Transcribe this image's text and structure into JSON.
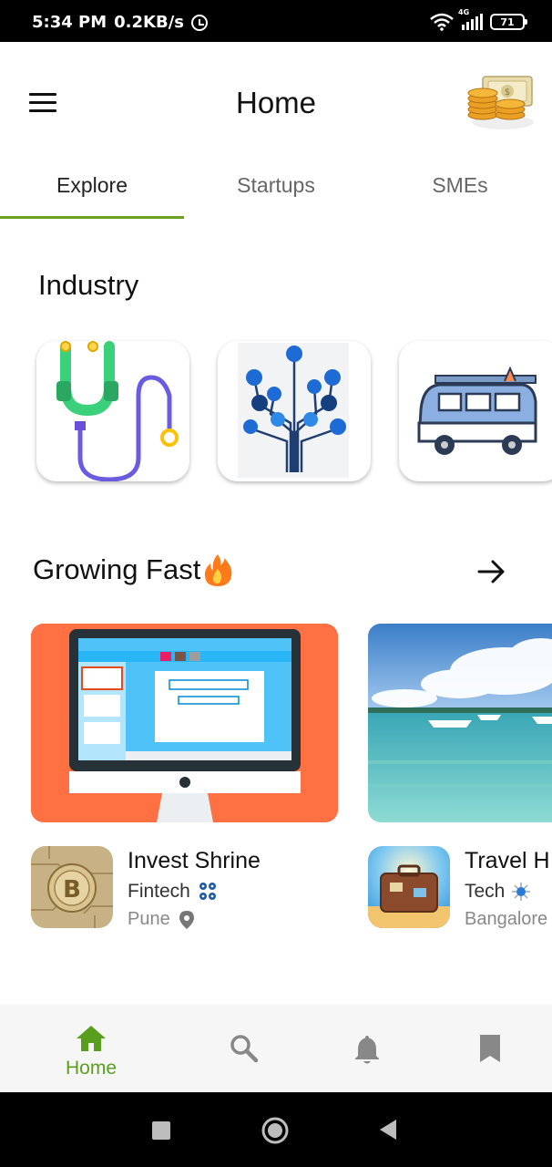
{
  "status_bar": {
    "time": "5:34 PM",
    "speed": "0.2KB/s",
    "network": "4G",
    "battery": "71"
  },
  "header": {
    "title": "Home"
  },
  "tabs": [
    {
      "label": "Explore",
      "active": true
    },
    {
      "label": "Startups",
      "active": false
    },
    {
      "label": "SMEs",
      "active": false
    }
  ],
  "industry": {
    "title": "Industry",
    "cards": [
      {
        "icon": "stethoscope-icon"
      },
      {
        "icon": "tech-tree-icon"
      },
      {
        "icon": "van-icon"
      }
    ]
  },
  "growing_fast": {
    "title": "Growing Fast",
    "title_emoji": "🔥",
    "companies": [
      {
        "name": "Invest Shrine",
        "category": "Fintech",
        "location": "Pune",
        "logo": "bitcoin-icon"
      },
      {
        "name": "Travel H",
        "category": "Tech",
        "location": "Bangalore",
        "logo": "suitcase-icon"
      }
    ]
  },
  "bottom_nav": {
    "items": [
      {
        "label": "Home",
        "icon": "home-icon",
        "active": true
      },
      {
        "label": "",
        "icon": "search-icon",
        "active": false
      },
      {
        "label": "",
        "icon": "bell-icon",
        "active": false
      },
      {
        "label": "",
        "icon": "bookmark-icon",
        "active": false
      }
    ]
  },
  "colors": {
    "accent": "#6aa121",
    "nav_active": "#5a9e1f",
    "feature_bg": "#ff7043"
  }
}
